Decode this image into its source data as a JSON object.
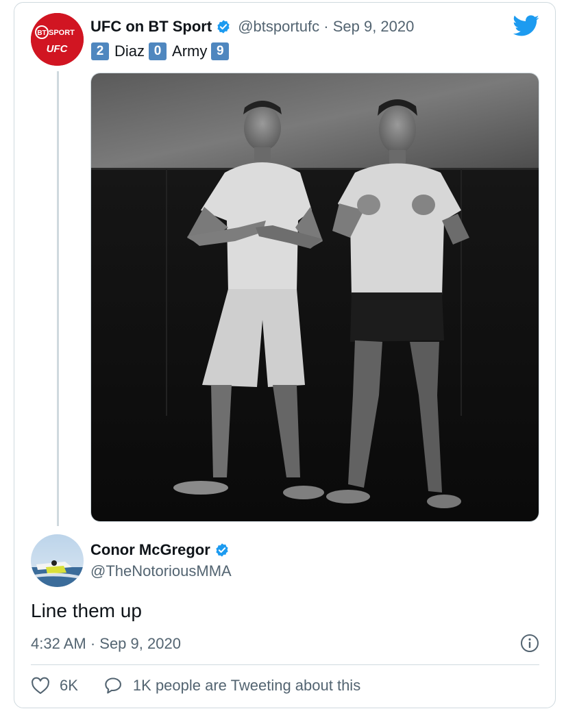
{
  "original_tweet": {
    "author_name": "UFC on BT Sport",
    "verified": true,
    "handle": "@btsportufc",
    "separator": "·",
    "date": "Sep 9, 2020",
    "avatar": {
      "top_text": "BT SPORT",
      "bottom_text": "UFC",
      "bg_color": "#d11522"
    },
    "score_line": {
      "items": [
        {
          "type": "key",
          "text": "2"
        },
        {
          "type": "word",
          "text": "Diaz"
        },
        {
          "type": "key",
          "text": "0"
        },
        {
          "type": "word",
          "text": "Army"
        },
        {
          "type": "key",
          "text": "9"
        }
      ]
    },
    "media": {
      "icon": "photo"
    }
  },
  "reply": {
    "author_name": "Conor McGregor",
    "verified": true,
    "handle": "@TheNotoriousMMA",
    "text": "Line them up",
    "timestamp": "4:32 AM · Sep 9, 2020"
  },
  "actions": {
    "likes_count": "6K",
    "conversation_label": "1K people are Tweeting about this"
  },
  "icons": {
    "brand": "twitter-bird-icon",
    "verified": "verified-badge-icon",
    "info": "info-icon",
    "like": "heart-icon",
    "reply": "speech-bubble-icon"
  },
  "colors": {
    "twitter_blue": "#1d9bf0",
    "key_blue": "#4f87bf",
    "secondary_text": "#536471",
    "border": "#cfd9de"
  }
}
